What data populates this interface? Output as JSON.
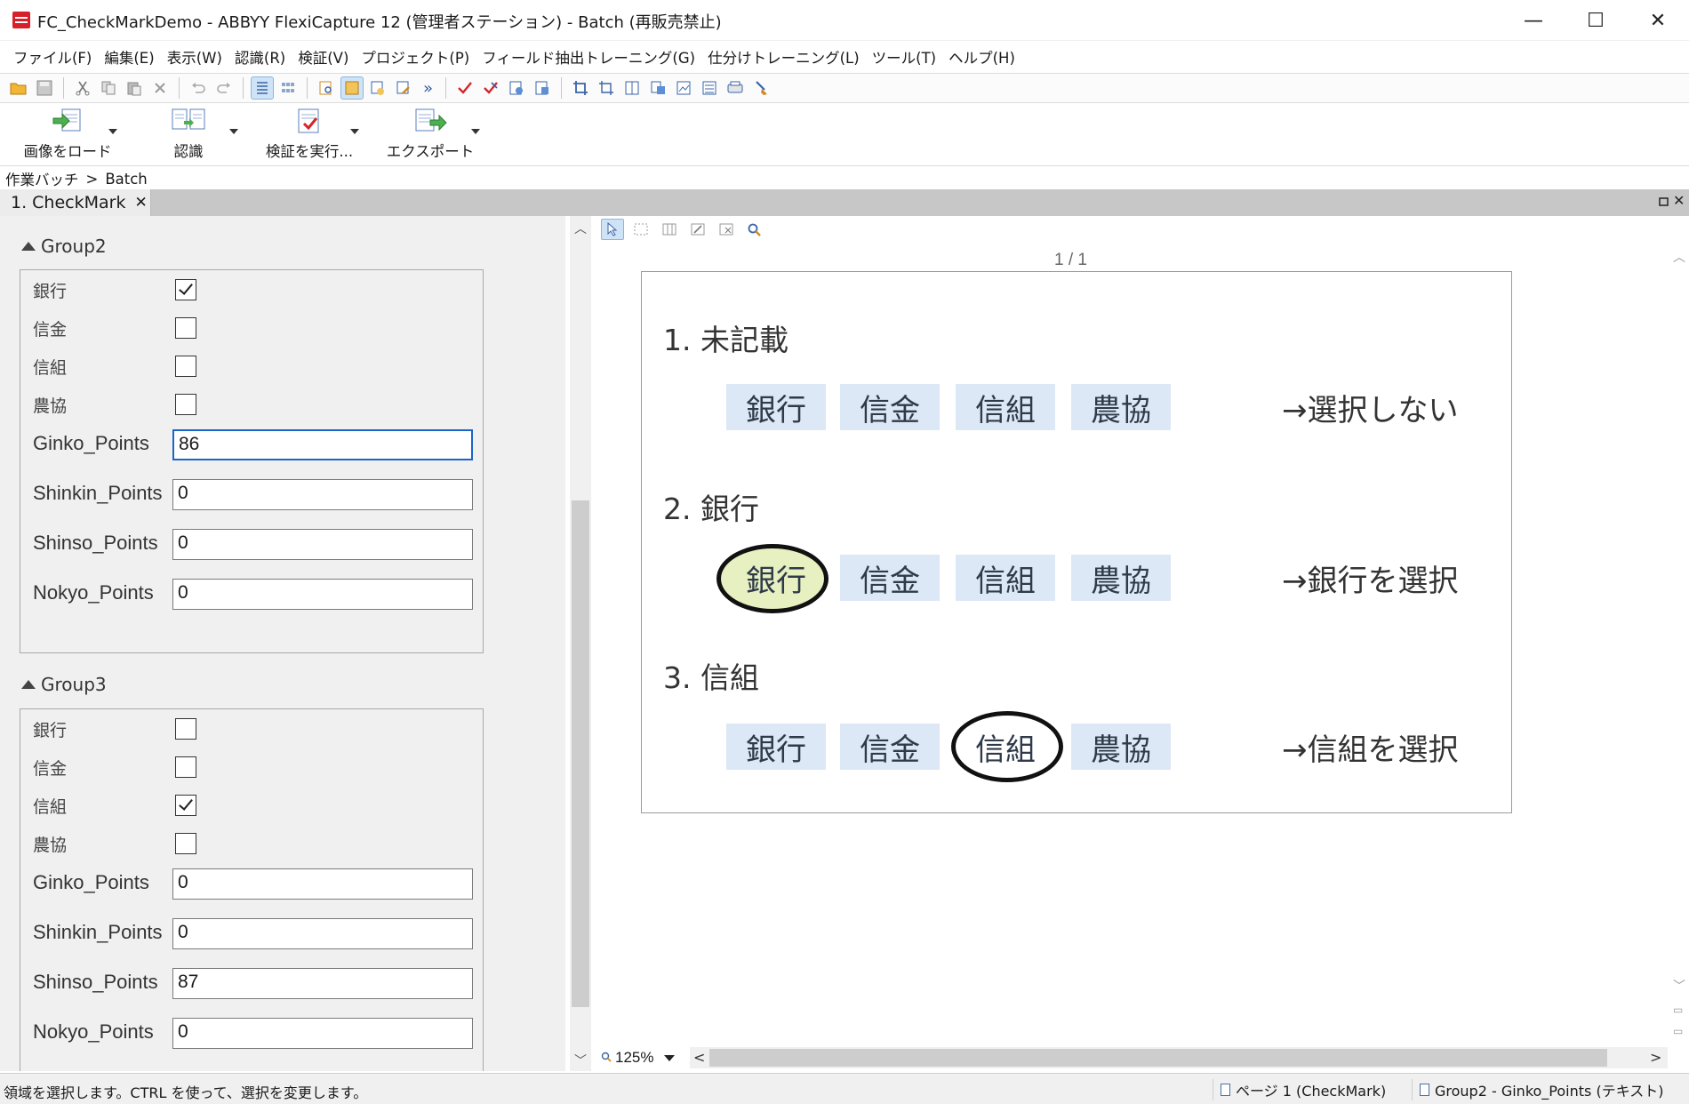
{
  "window": {
    "title": "FC_CheckMarkDemo - ABBYY FlexiCapture 12 (管理者ステーション) - Batch (再販売禁止)",
    "minimize_glyph": "—",
    "maximize_glyph": "☐",
    "close_glyph": "✕"
  },
  "menu": [
    "ファイル(F)",
    "編集(E)",
    "表示(W)",
    "認識(R)",
    "検証(V)",
    "プロジェクト(P)",
    "フィールド抽出トレーニング(G)",
    "仕分けトレーニング(L)",
    "ツール(T)",
    "ヘルプ(H)"
  ],
  "toolbar": {
    "more_glyph": "»",
    "big_buttons": [
      {
        "label": "画像をロード",
        "icon": "load-images-icon"
      },
      {
        "label": "認識",
        "icon": "recognize-icon"
      },
      {
        "label": "検証を実行...",
        "icon": "verify-icon"
      },
      {
        "label": "エクスポート",
        "icon": "export-icon"
      }
    ]
  },
  "breadcrumb": {
    "root": "作業バッチ",
    "sep": ">",
    "current": "Batch"
  },
  "tab": {
    "label": "1. CheckMark",
    "close": "✕"
  },
  "groups": [
    {
      "name": "Group2",
      "checks": [
        {
          "label": "銀行",
          "checked": true
        },
        {
          "label": "信金",
          "checked": false
        },
        {
          "label": "信組",
          "checked": false
        },
        {
          "label": "農協",
          "checked": false
        }
      ],
      "points": [
        {
          "label": "Ginko_Points",
          "value": "86"
        },
        {
          "label": "Shinkin_Points",
          "value": "0"
        },
        {
          "label": "Shinso_Points",
          "value": "0"
        },
        {
          "label": "Nokyo_Points",
          "value": "0"
        }
      ]
    },
    {
      "name": "Group3",
      "checks": [
        {
          "label": "銀行",
          "checked": false
        },
        {
          "label": "信金",
          "checked": false
        },
        {
          "label": "信組",
          "checked": true
        },
        {
          "label": "農協",
          "checked": false
        }
      ],
      "points": [
        {
          "label": "Ginko_Points",
          "value": "0"
        },
        {
          "label": "Shinkin_Points",
          "value": "0"
        },
        {
          "label": "Shinso_Points",
          "value": "87"
        },
        {
          "label": "Nokyo_Points",
          "value": "0"
        }
      ]
    }
  ],
  "viewer": {
    "page_indicator": "1 / 1",
    "zoom": "125%",
    "sections": [
      {
        "title": "1. 未記載",
        "chips": [
          "銀行",
          "信金",
          "信組",
          "農協"
        ],
        "marked": -1,
        "result": "→選択しない"
      },
      {
        "title": "2. 銀行",
        "chips": [
          "銀行",
          "信金",
          "信組",
          "農協"
        ],
        "marked": 0,
        "result": "→銀行を選択"
      },
      {
        "title": "3. 信組",
        "chips": [
          "銀行",
          "信金",
          "信組",
          "農協"
        ],
        "marked": 2,
        "result": "→信組を選択"
      }
    ]
  },
  "status": {
    "message": "領域を選択します。CTRL を使って、選択を変更します。",
    "page": "ページ 1 (CheckMark)",
    "field": "Group2 - Ginko_Points (テキスト)"
  }
}
